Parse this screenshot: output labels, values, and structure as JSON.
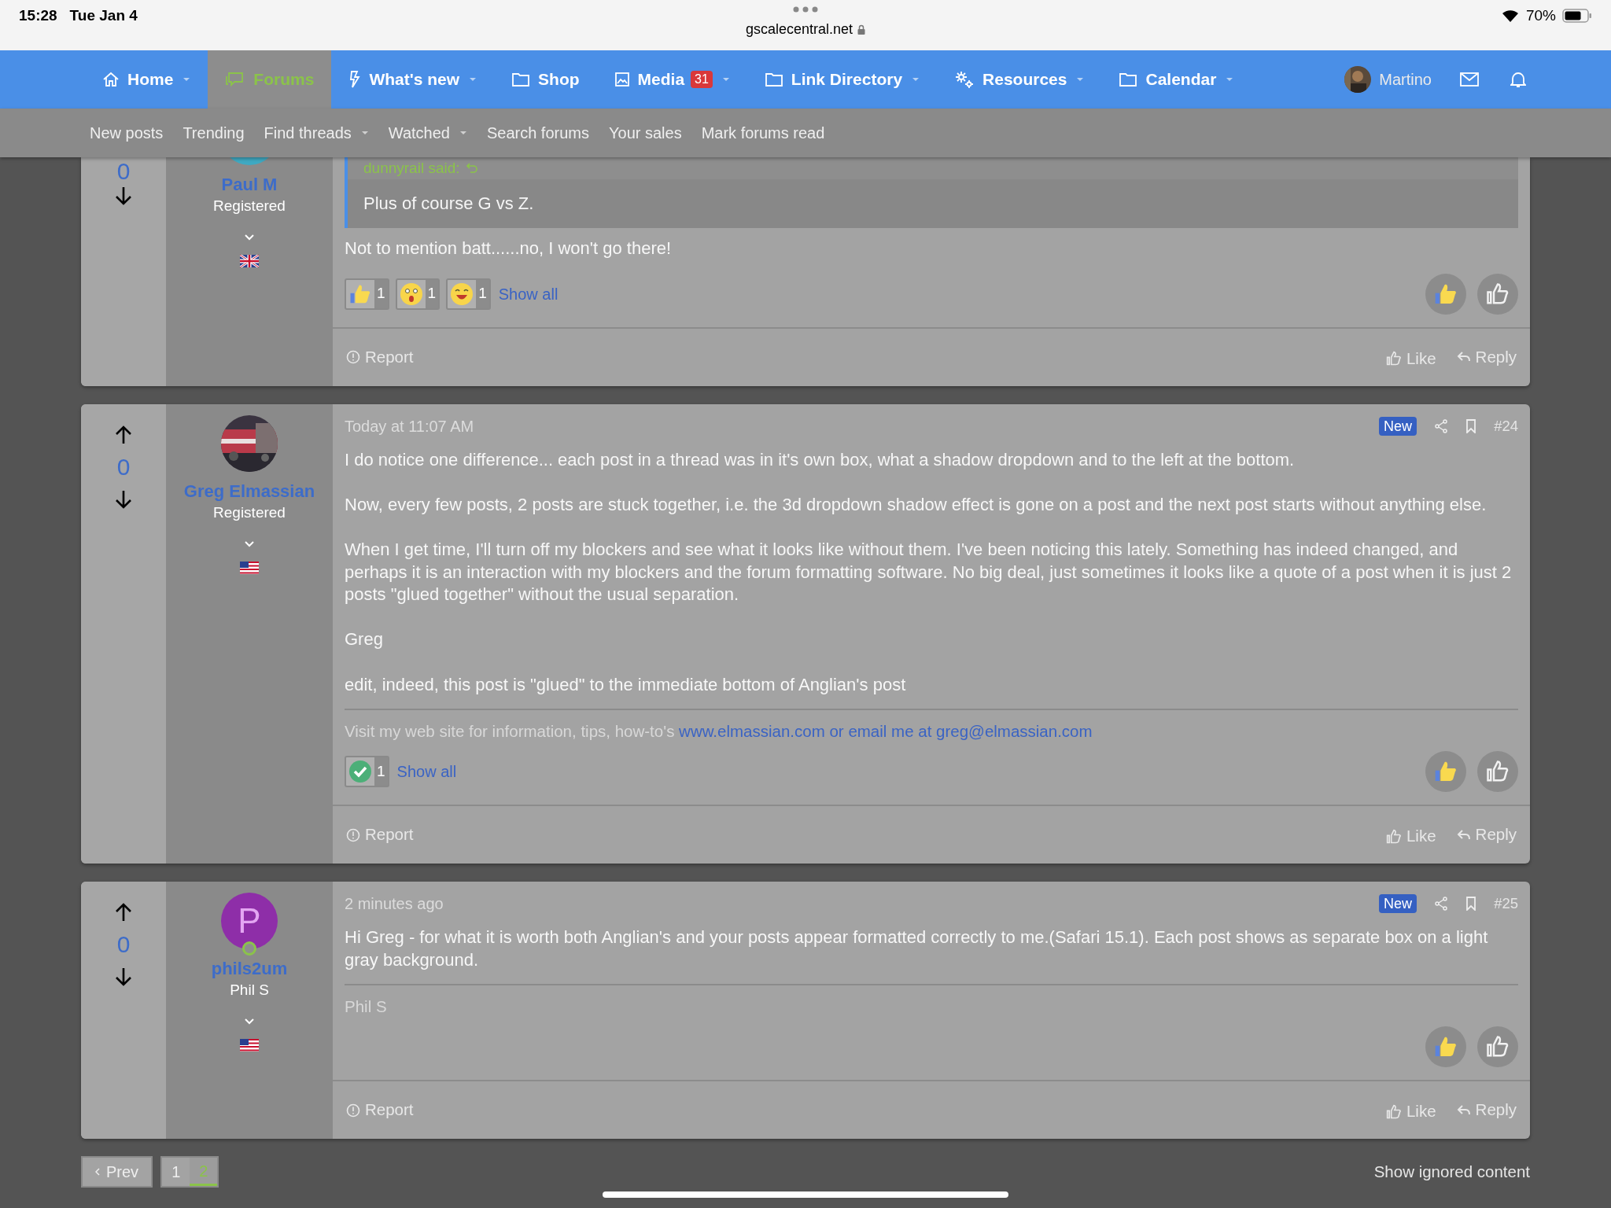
{
  "status_bar": {
    "time": "15:28",
    "date": "Tue Jan 4",
    "url": "gscalecentral.net",
    "battery": "70%"
  },
  "nav": {
    "items": [
      {
        "label": "Home",
        "dropdown": true,
        "selected": false
      },
      {
        "label": "Forums",
        "dropdown": false,
        "selected": true
      },
      {
        "label": "What's new",
        "dropdown": true,
        "selected": false
      },
      {
        "label": "Shop",
        "dropdown": false,
        "selected": false
      },
      {
        "label": "Media",
        "dropdown": true,
        "selected": false,
        "badge": "31"
      },
      {
        "label": "Link Directory",
        "dropdown": true,
        "selected": false
      },
      {
        "label": "Resources",
        "dropdown": true,
        "selected": false
      },
      {
        "label": "Calendar",
        "dropdown": true,
        "selected": false
      }
    ],
    "user": {
      "name": "Martino"
    }
  },
  "subnav": [
    {
      "label": "New posts",
      "dropdown": false
    },
    {
      "label": "Trending",
      "dropdown": false
    },
    {
      "label": "Find threads",
      "dropdown": true
    },
    {
      "label": "Watched",
      "dropdown": true
    },
    {
      "label": "Search forums",
      "dropdown": false
    },
    {
      "label": "Your sales",
      "dropdown": false
    },
    {
      "label": "Mark forums read",
      "dropdown": false
    }
  ],
  "posts": [
    {
      "votes": "0",
      "user": {
        "name": "Paul M",
        "title": "Registered"
      },
      "quote": {
        "author": "dunnyrail said:",
        "text": "Plus of course G vs Z."
      },
      "paragraphs": [
        "Not to mention batt......no, I won't go there!"
      ],
      "reactions": [
        {
          "kind": "like",
          "count": "1"
        },
        {
          "kind": "wow",
          "count": "1"
        },
        {
          "kind": "laugh",
          "count": "1"
        }
      ],
      "show_all": "Show all",
      "footer": {
        "report": "Report",
        "like": "Like",
        "reply": "Reply"
      }
    },
    {
      "votes": "0",
      "user": {
        "name": "Greg Elmassian",
        "title": "Registered"
      },
      "timestamp": "Today at 11:07 AM",
      "badge": "New",
      "number": "#24",
      "paragraphs": [
        "I do notice one difference... each post in a thread was in it's own box, what a shadow dropdown and to the left at the bottom.",
        "Now, every few posts, 2 posts are stuck together, i.e. the 3d dropdown shadow effect is gone on a post and the next post starts without anything else.",
        "When I get time, I'll turn off my blockers and see what it looks like without them. I've been noticing this lately. Something has indeed changed, and perhaps it is an interaction with my blockers and the forum formatting software. No big deal, just sometimes it looks like a quote of a post when it is just 2 posts \"glued together\" without the usual separation.",
        "Greg",
        "edit, indeed, this post is \"glued\" to the immediate bottom of Anglian's post"
      ],
      "signature": {
        "text": "Visit my web site for information, tips, how-to's",
        "link": "www.elmassian.com or email me at greg@elmassian.com"
      },
      "reactions": [
        {
          "kind": "agree",
          "count": "1"
        }
      ],
      "show_all": "Show all",
      "footer": {
        "report": "Report",
        "like": "Like",
        "reply": "Reply"
      }
    },
    {
      "votes": "0",
      "user": {
        "name": "phils2um",
        "title": "Phil S",
        "letter": "P",
        "online": true
      },
      "timestamp": "2 minutes ago",
      "badge": "New",
      "number": "#25",
      "paragraphs": [
        "Hi Greg - for what it is worth both Anglian's and your posts appear formatted correctly to me.(Safari 15.1). Each post shows as separate box on a light gray background."
      ],
      "signature": {
        "text": "Phil S"
      },
      "footer": {
        "report": "Report",
        "like": "Like",
        "reply": "Reply"
      }
    }
  ],
  "pagination": {
    "prev": "Prev",
    "pages": [
      {
        "label": "1",
        "selected": false
      },
      {
        "label": "2",
        "selected": true
      }
    ],
    "show_ignored": "Show ignored content"
  }
}
